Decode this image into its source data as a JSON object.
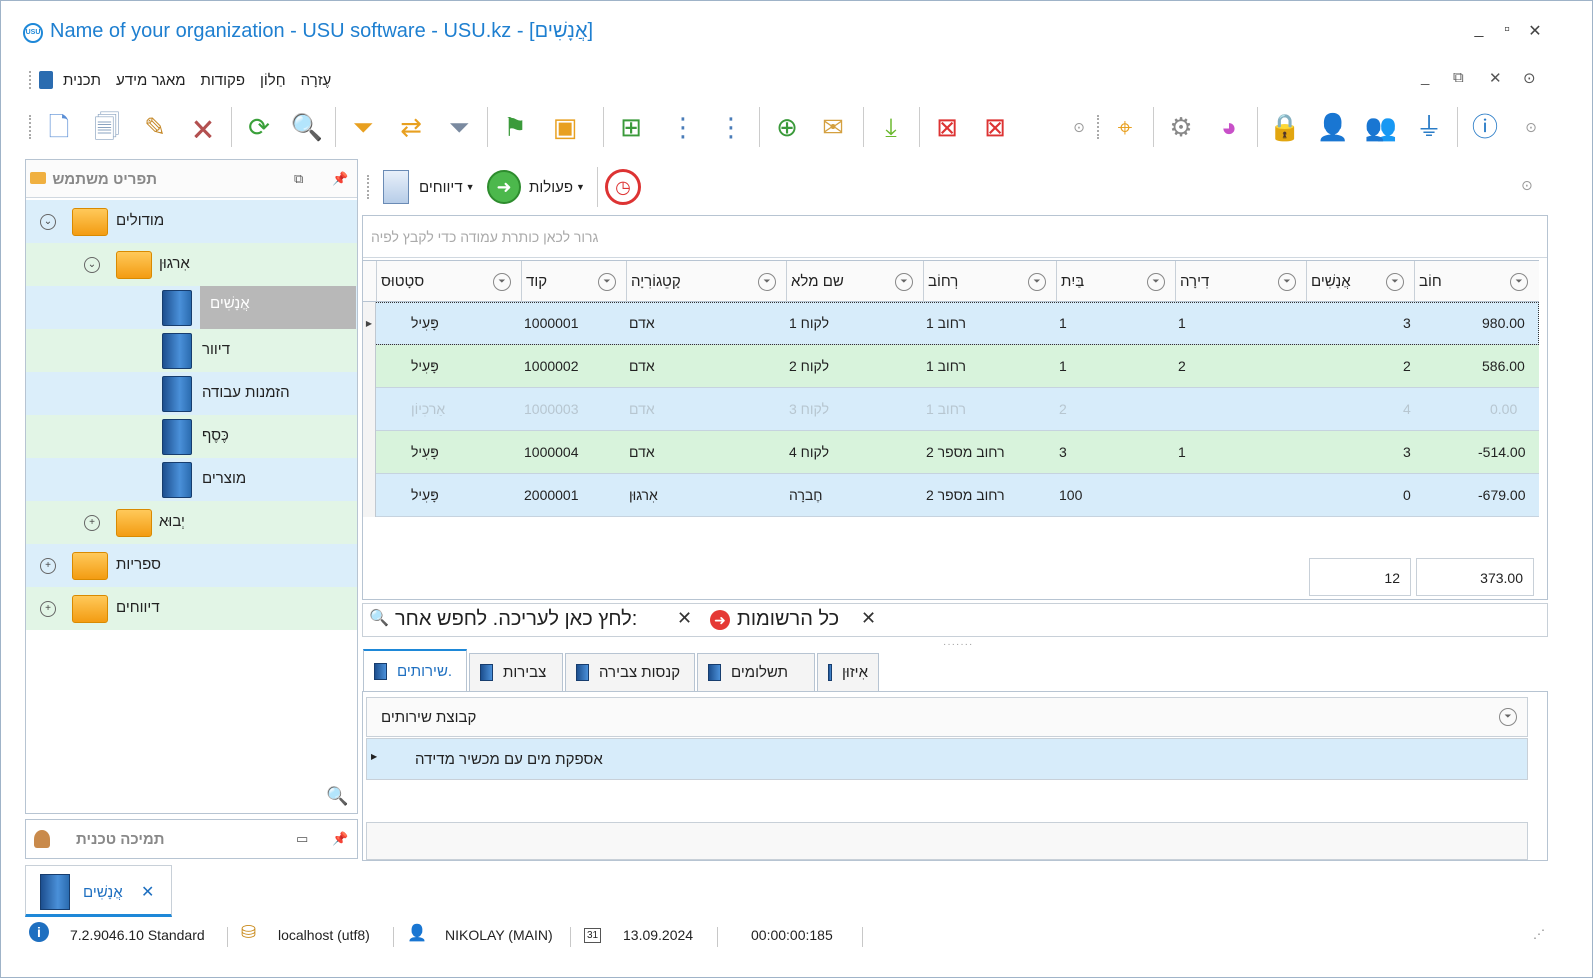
{
  "window": {
    "title": "Name of your organization - USU software - USU.kz - [אֲנָשִׁים]",
    "logo": "USU",
    "controls": [
      "_",
      "▫",
      "✕"
    ]
  },
  "menu": [
    "עֶזרָה",
    "חַלוֹן",
    "פקודות",
    "מאגר מידע",
    "תכנית"
  ],
  "mdi_controls": [
    "_",
    "⧉",
    "✕",
    "⊙"
  ],
  "toolbar": {
    "icons": [
      "new-doc-icon",
      "copy-icon",
      "edit-icon",
      "delete-icon",
      "refresh-icon",
      "search-icon",
      "filter-icon",
      "filter-edit-icon",
      "filter-clear-icon",
      "flag-icon",
      "image-icon",
      "expand-icon",
      "tree-icon",
      "tree-up-icon",
      "add-column-icon",
      "notes-icon",
      "download-icon",
      "close-window-icon",
      "close-all-icon",
      "location-icon",
      "gear-icon",
      "color-wheel-icon",
      "lock-icon",
      "user-key-icon",
      "users-icon",
      "plug-icon",
      "info-icon"
    ]
  },
  "left_panel": {
    "title": "תפריט משתמש",
    "tree": [
      {
        "label": "מודולים",
        "level": 0,
        "type": "folder",
        "state": "open"
      },
      {
        "label": "אִרגוּן",
        "level": 1,
        "type": "folder",
        "state": "open"
      },
      {
        "label": "אֲנָשִׁים",
        "level": 2,
        "type": "book",
        "selected": true
      },
      {
        "label": "דיוור",
        "level": 2,
        "type": "book"
      },
      {
        "label": "הזמנות עבודה",
        "level": 2,
        "type": "book"
      },
      {
        "label": "כֶּסֶף",
        "level": 2,
        "type": "book"
      },
      {
        "label": "מוצרים",
        "level": 2,
        "type": "book"
      },
      {
        "label": "יְבוּא",
        "level": 1,
        "type": "folder",
        "state": "closed"
      },
      {
        "label": "ספריות",
        "level": 0,
        "type": "folder",
        "state": "closed"
      },
      {
        "label": "דיווחים",
        "level": 0,
        "type": "folder",
        "state": "closed"
      }
    ],
    "support_title": "תמיכה טכנית"
  },
  "main_toolbar": {
    "reports": "דיווחים",
    "actions": "פעולות"
  },
  "grid": {
    "group_hint": "גרור לכאן כותרת עמודה כדי לקבץ לפיה",
    "columns": [
      "סטָטוּס",
      "קוד",
      "קָטֵגוֹרִיָה",
      "שם מלא",
      "רְחוֹב",
      "בַּיִת",
      "דִירָה",
      "אֲנָשִׁים",
      "חוֹב"
    ],
    "rows": [
      {
        "status": "פָּעִיל",
        "code": "1000001",
        "category": "אדם",
        "name": "לקוח 1",
        "street": "רחוב 1",
        "house": "1",
        "apt": "1",
        "people": "3",
        "debt": "980.00"
      },
      {
        "status": "פָּעִיל",
        "code": "1000002",
        "category": "אדם",
        "name": "לקוח 2",
        "street": "רחוב 1",
        "house": "1",
        "apt": "2",
        "people": "2",
        "debt": "586.00"
      },
      {
        "status": "אַרכִיוֹן",
        "code": "1000003",
        "category": "אדם",
        "name": "לקוח 3",
        "street": "רחוב 1",
        "house": "2",
        "apt": "",
        "people": "4",
        "debt": "0.00"
      },
      {
        "status": "פָּעִיל",
        "code": "1000004",
        "category": "אדם",
        "name": "לקוח 4",
        "street": "רחוב מספר 2",
        "house": "3",
        "apt": "1",
        "people": "3",
        "debt": "-514.00"
      },
      {
        "status": "פָּעִיל",
        "code": "2000001",
        "category": "אִרגוּן",
        "name": "חֶברָה",
        "street": "רחוב מספר 2",
        "house": "100",
        "apt": "",
        "people": "0",
        "debt": "-679.00"
      }
    ],
    "totals": {
      "people": "12",
      "debt": "373.00"
    }
  },
  "filter_bar": {
    "search_text": "לחץ כאן לעריכה. לחפש אחר:",
    "all_records": "כל הרשומות"
  },
  "tabs": [
    "אִיזוּן",
    "תשלומים",
    "קנסות צבירה",
    "צבירות",
    "שירותים."
  ],
  "subgrid": {
    "column": "קבוצת שירותים",
    "rows": [
      "אספקת מים עם מכשיר מדידה"
    ]
  },
  "doc_tab": {
    "label": "אֲנָשִׁים"
  },
  "status": {
    "version": "7.2.9046.10 Standard",
    "db": "localhost (utf8)",
    "user": "NIKOLAY (MAIN)",
    "date": "13.09.2024",
    "timer": "00:00:00:185",
    "calendar_day": "31"
  }
}
